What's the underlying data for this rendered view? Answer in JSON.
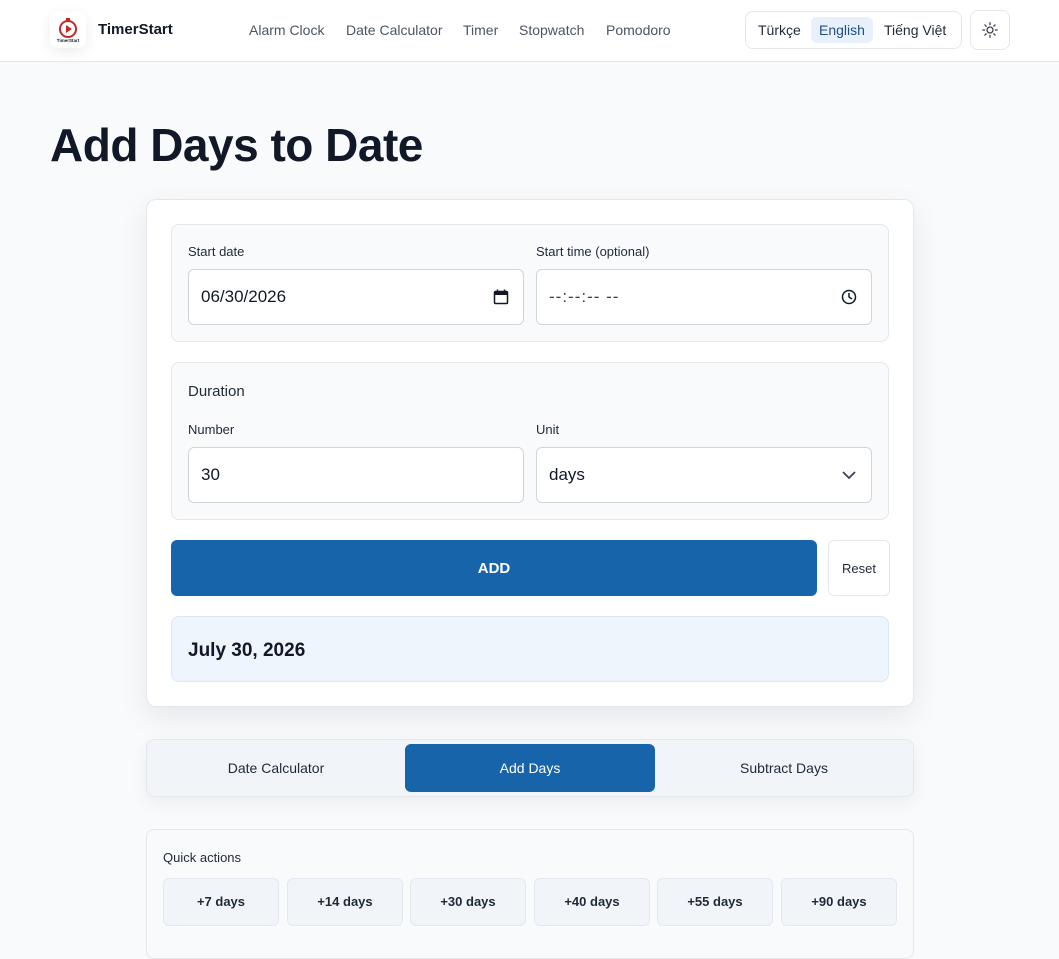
{
  "header": {
    "brand": "TimerStart",
    "logo_text": "TimerStart",
    "nav": [
      "Alarm Clock",
      "Date Calculator",
      "Timer",
      "Stopwatch",
      "Pomodoro"
    ],
    "languages": [
      "Türkçe",
      "English",
      "Tiếng Việt"
    ],
    "active_language": "English",
    "theme_icon": "sun-icon"
  },
  "page": {
    "title": "Add Days to Date"
  },
  "form": {
    "start_date_label": "Start date",
    "start_date_value": "06/30/2026",
    "start_time_label": "Start time (optional)",
    "start_time_value": "--:--:-- --",
    "duration_title": "Duration",
    "number_label": "Number",
    "number_value": "30",
    "unit_label": "Unit",
    "unit_value": "days",
    "add_label": "ADD",
    "reset_label": "Reset",
    "result": "July 30, 2026"
  },
  "tabs": {
    "items": [
      "Date Calculator",
      "Add Days",
      "Subtract Days"
    ],
    "active": "Add Days"
  },
  "quick_actions": {
    "title": "Quick actions",
    "items": [
      "+7 days",
      "+14 days",
      "+30 days",
      "+40 days",
      "+55 days",
      "+90 days"
    ]
  },
  "colors": {
    "accent": "#1864ab",
    "result_bg": "#eef5fd",
    "logo_red": "#c62828"
  }
}
